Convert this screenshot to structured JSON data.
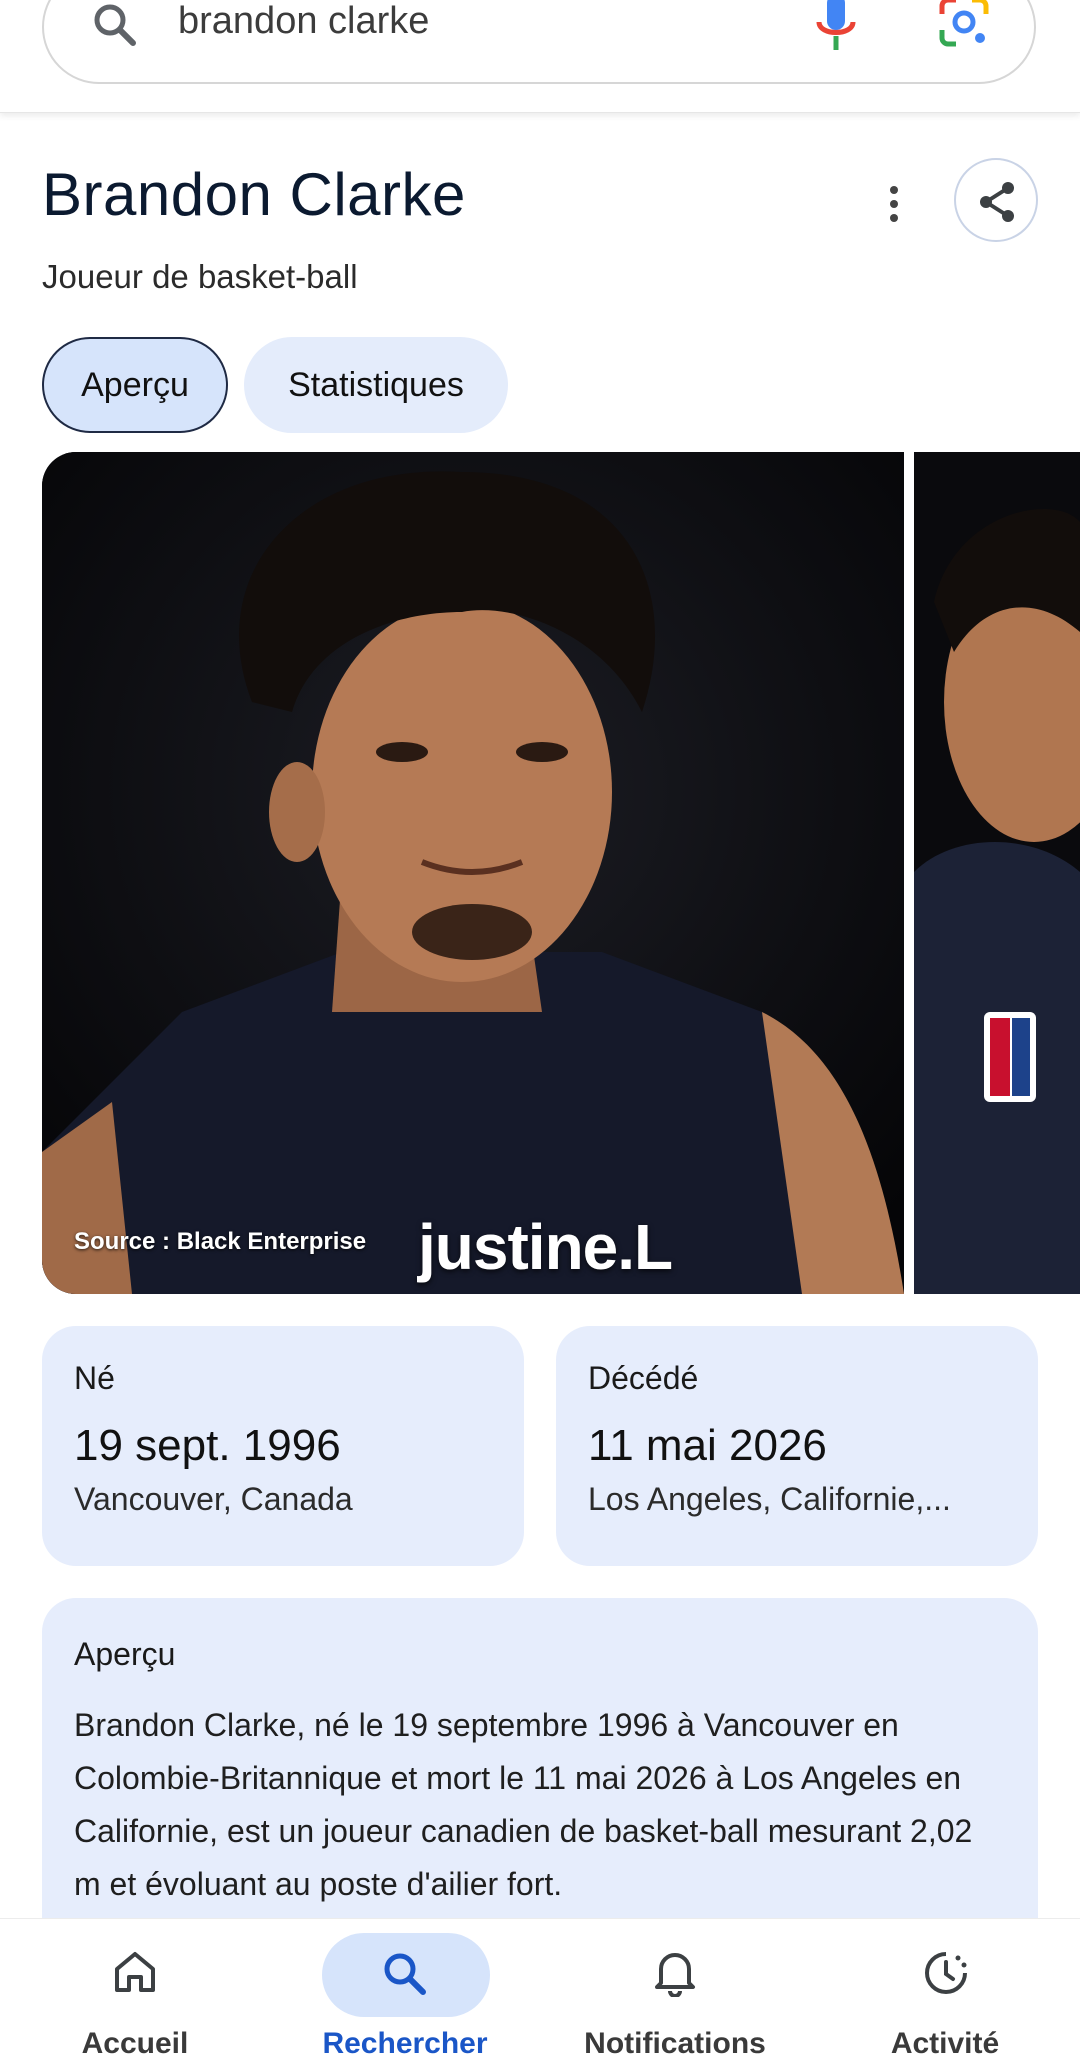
{
  "search": {
    "query": "brandon clarke"
  },
  "entity": {
    "title": "Brandon Clarke",
    "subtitle": "Joueur de basket-ball"
  },
  "tabs": [
    {
      "label": "Aperçu",
      "selected": true
    },
    {
      "label": "Statistiques",
      "selected": false
    }
  ],
  "images": {
    "caption": "Source : Black Enterprise",
    "watermark": "justine.L"
  },
  "born": {
    "label": "Né",
    "date": "19 sept. 1996",
    "place": "Vancouver, Canada"
  },
  "died": {
    "label": "Décédé",
    "date": "11 mai 2026",
    "place": "Los Angeles, Californie,..."
  },
  "overview": {
    "title": "Aperçu",
    "text": "Brandon Clarke, né le 19 septembre 1996 à Vancouver en Colombie-Britannique et mort le 11 mai 2026 à Los Angeles en Californie, est un joueur canadien de basket-ball mesurant 2,02 m et évoluant au poste d'ailier fort."
  },
  "bottom_nav": [
    {
      "label": "Accueil",
      "icon": "home-icon",
      "active": false
    },
    {
      "label": "Rechercher",
      "icon": "search-icon",
      "active": true
    },
    {
      "label": "Notifications",
      "icon": "bell-icon",
      "active": false
    },
    {
      "label": "Activité",
      "icon": "activity-icon",
      "active": false
    }
  ],
  "colors": {
    "accent": "#1a56c7",
    "card_bg": "#e6edfc",
    "tab_selected_bg": "#d6e4fb",
    "title": "#0b1a30"
  }
}
